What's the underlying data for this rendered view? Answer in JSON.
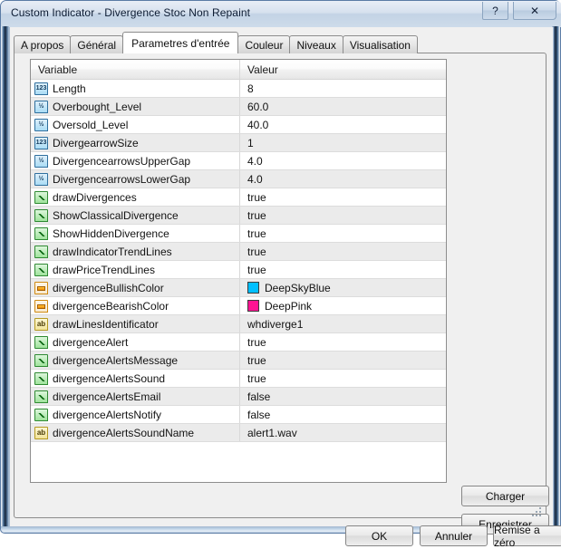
{
  "window": {
    "title": "Custom Indicator - Divergence Stoc Non Repaint",
    "help_button": "?",
    "close_button": "✕"
  },
  "tabs": [
    {
      "label": "A propos",
      "active": false
    },
    {
      "label": "Général",
      "active": false
    },
    {
      "label": "Parametres d'entrée",
      "active": true
    },
    {
      "label": "Couleur",
      "active": false
    },
    {
      "label": "Niveaux",
      "active": false
    },
    {
      "label": "Visualisation",
      "active": false
    }
  ],
  "grid": {
    "columns": [
      "Variable",
      "Valeur"
    ],
    "rows": [
      {
        "icon": "integer-icon",
        "type": "int",
        "variable": "Length",
        "value": "8"
      },
      {
        "icon": "double-icon",
        "type": "dbl",
        "variable": "Overbought_Level",
        "value": "60.0"
      },
      {
        "icon": "double-icon",
        "type": "dbl",
        "variable": "Oversold_Level",
        "value": "40.0"
      },
      {
        "icon": "integer-icon",
        "type": "int",
        "variable": "DivergearrowSize",
        "value": "1"
      },
      {
        "icon": "double-icon",
        "type": "dbl",
        "variable": "DivergencearrowsUpperGap",
        "value": "4.0"
      },
      {
        "icon": "double-icon",
        "type": "dbl",
        "variable": "DivergencearrowsLowerGap",
        "value": "4.0"
      },
      {
        "icon": "boolean-icon",
        "type": "bool",
        "variable": "drawDivergences",
        "value": "true"
      },
      {
        "icon": "boolean-icon",
        "type": "bool",
        "variable": "ShowClassicalDivergence",
        "value": "true"
      },
      {
        "icon": "boolean-icon",
        "type": "bool",
        "variable": "ShowHiddenDivergence",
        "value": "true"
      },
      {
        "icon": "boolean-icon",
        "type": "bool",
        "variable": "drawIndicatorTrendLines",
        "value": "true"
      },
      {
        "icon": "boolean-icon",
        "type": "bool",
        "variable": "drawPriceTrendLines",
        "value": "true"
      },
      {
        "icon": "color-icon",
        "type": "color",
        "variable": "divergenceBullishColor",
        "value": "DeepSkyBlue",
        "swatch": "#00BFFF"
      },
      {
        "icon": "color-icon",
        "type": "color",
        "variable": "divergenceBearishColor",
        "value": "DeepPink",
        "swatch": "#FF1493"
      },
      {
        "icon": "string-icon",
        "type": "str",
        "variable": "drawLinesIdentificator",
        "value": "whdiverge1"
      },
      {
        "icon": "boolean-icon",
        "type": "bool",
        "variable": "divergenceAlert",
        "value": "true"
      },
      {
        "icon": "boolean-icon",
        "type": "bool",
        "variable": "divergenceAlertsMessage",
        "value": "true"
      },
      {
        "icon": "boolean-icon",
        "type": "bool",
        "variable": "divergenceAlertsSound",
        "value": "true"
      },
      {
        "icon": "boolean-icon",
        "type": "bool",
        "variable": "divergenceAlertsEmail",
        "value": "false"
      },
      {
        "icon": "boolean-icon",
        "type": "bool",
        "variable": "divergenceAlertsNotify",
        "value": "false"
      },
      {
        "icon": "string-icon",
        "type": "str",
        "variable": "divergenceAlertsSoundName",
        "value": "alert1.wav"
      }
    ],
    "icon_text": {
      "int": "123",
      "dbl": "½",
      "str": "ab",
      "bool": "",
      "color": ""
    }
  },
  "side_buttons": {
    "load": "Charger",
    "save": "Enregistrer"
  },
  "bottom_buttons": {
    "ok": "OK",
    "cancel": "Annuler",
    "reset": "Remise a zéro"
  }
}
